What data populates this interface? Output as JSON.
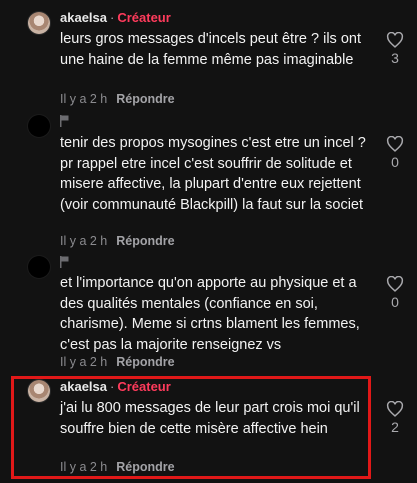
{
  "comments": [
    {
      "username": "akaelsa",
      "separator": "·",
      "badge": "Créateur",
      "text": "leurs gros messages d'incels peut être ? ils ont une haine de la femme même pas imaginable",
      "time": "Il y a 2 h",
      "reply_label": "Répondre",
      "likes": "3"
    },
    {
      "username": "",
      "text": "tenir des propos mysogines c'est etre un incel ? pr rappel etre incel c'est souffrir de solitude et misere affective, la plupart d'entre eux rejettent (voir communauté Blackpill) la faut sur la societ",
      "time": "Il y a 2 h",
      "reply_label": "Répondre",
      "likes": "0"
    },
    {
      "username": "",
      "text": "et l'importance qu'on apporte au physique et a des qualités mentales (confiance en soi, charisme). Meme si crtns blament les femmes, c'est pas la majorite renseignez vs",
      "time": "Il y a 2 h",
      "reply_label": "Répondre",
      "likes": "0"
    },
    {
      "username": "akaelsa",
      "separator": "·",
      "badge": "Créateur",
      "text": "j'ai lu 800 messages de leur part crois moi qu'il souffre bien de cette misère affective hein",
      "time": "Il y a 2 h",
      "reply_label": "Répondre",
      "likes": "2"
    }
  ],
  "icons": {
    "like": "heart-outline-icon",
    "flag": "flag-icon"
  },
  "colors": {
    "background": "#121212",
    "creator_badge": "#ff3b5c",
    "highlight_border": "#e11818",
    "secondary_text": "#8b8b8f"
  }
}
